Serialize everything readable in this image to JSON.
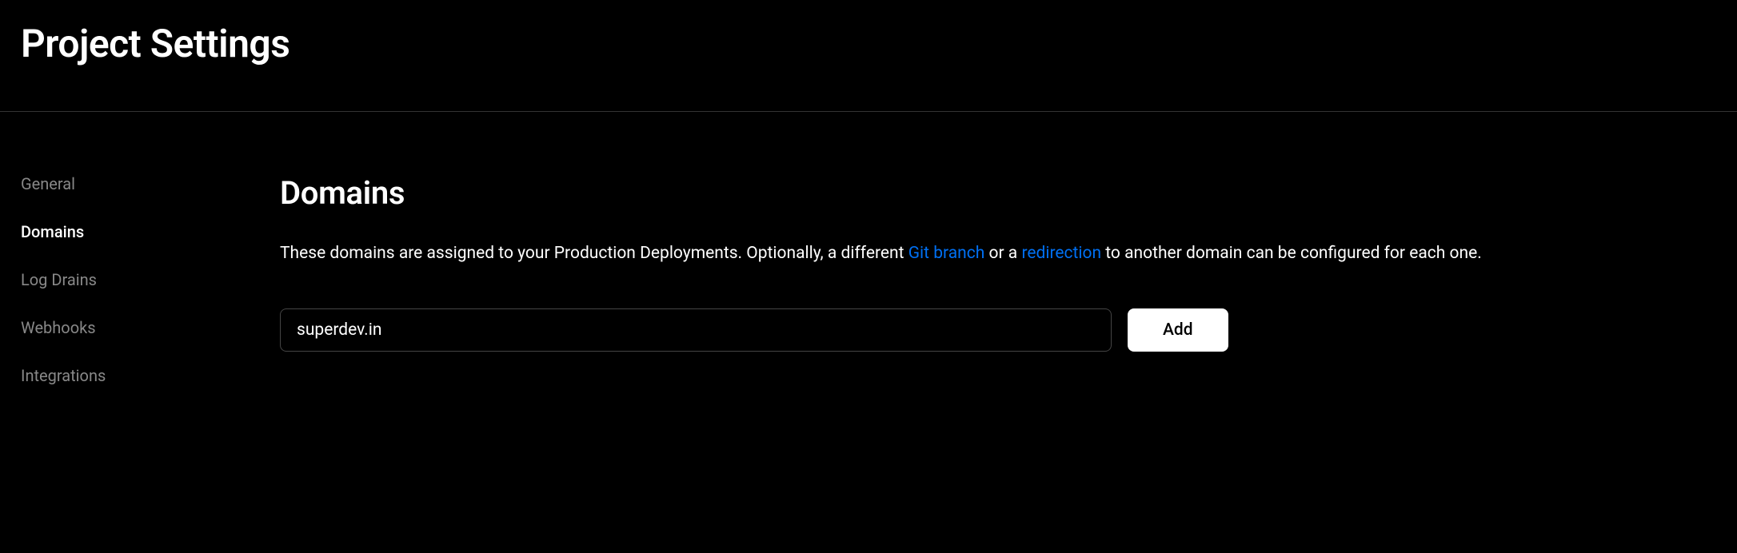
{
  "header": {
    "title": "Project Settings"
  },
  "sidebar": {
    "items": [
      {
        "label": "General",
        "active": false
      },
      {
        "label": "Domains",
        "active": true
      },
      {
        "label": "Log Drains",
        "active": false
      },
      {
        "label": "Webhooks",
        "active": false
      },
      {
        "label": "Integrations",
        "active": false
      }
    ]
  },
  "main": {
    "section_title": "Domains",
    "description_pre": "These domains are assigned to your Production Deployments. Optionally, a different ",
    "link_git_branch": "Git branch",
    "description_mid": " or a ",
    "link_redirection": "redirection",
    "description_post": " to another domain can be configured for each one.",
    "domain_input_value": "superdev.in",
    "domain_input_placeholder": "",
    "add_button_label": "Add"
  }
}
